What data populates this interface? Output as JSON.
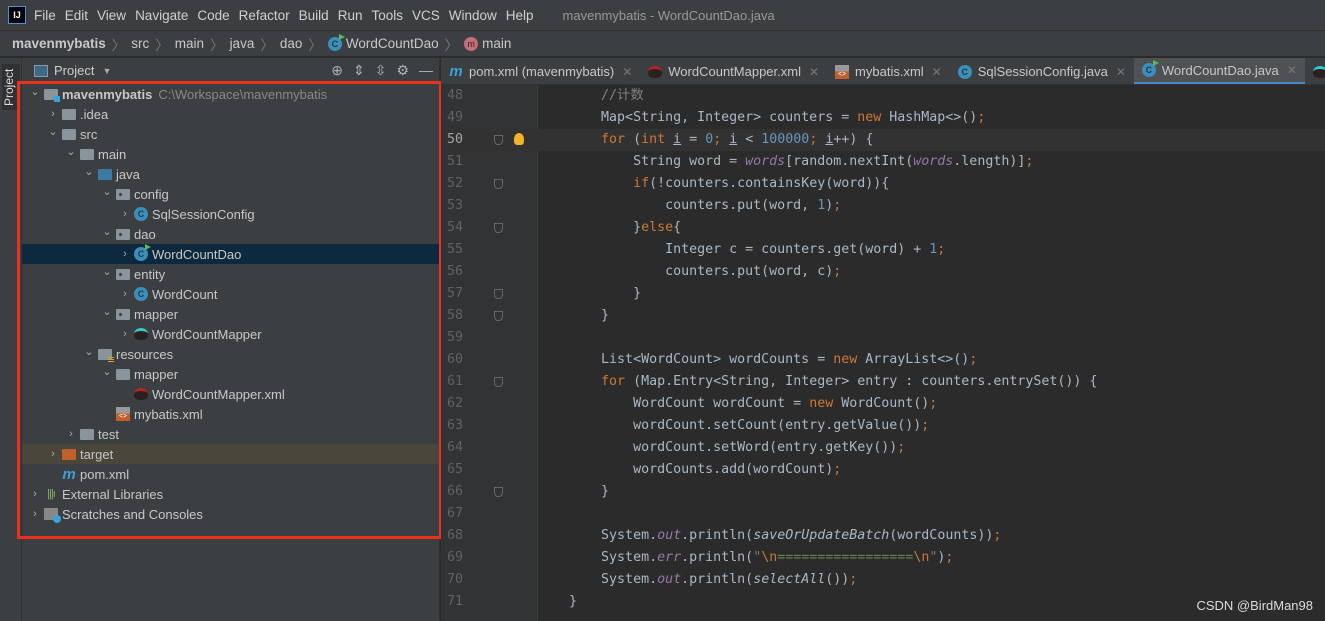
{
  "menubar": {
    "logo": "IJ",
    "items": [
      "File",
      "Edit",
      "View",
      "Navigate",
      "Code",
      "Refactor",
      "Build",
      "Run",
      "Tools",
      "VCS",
      "Window",
      "Help"
    ],
    "title": "mavenmybatis - WordCountDao.java"
  },
  "breadcrumb": {
    "items": [
      "mavenmybatis",
      "src",
      "main",
      "java",
      "dao",
      "WordCountDao",
      "main"
    ]
  },
  "sidebar": {
    "stripe_label": "Project"
  },
  "project": {
    "title": "Project",
    "tree": [
      {
        "label": "mavenmybatis",
        "path": "C:\\Workspace\\mavenmybatis",
        "depth": 0,
        "arrow": "open",
        "icon": "module-folder",
        "bold": true
      },
      {
        "label": ".idea",
        "depth": 1,
        "arrow": "closed",
        "icon": "folder"
      },
      {
        "label": "src",
        "depth": 1,
        "arrow": "open",
        "icon": "folder"
      },
      {
        "label": "main",
        "depth": 2,
        "arrow": "open",
        "icon": "folder"
      },
      {
        "label": "java",
        "depth": 3,
        "arrow": "open",
        "icon": "source-folder"
      },
      {
        "label": "config",
        "depth": 4,
        "arrow": "open",
        "icon": "package"
      },
      {
        "label": "SqlSessionConfig",
        "depth": 5,
        "arrow": "closed",
        "icon": "class"
      },
      {
        "label": "dao",
        "depth": 4,
        "arrow": "open",
        "icon": "package"
      },
      {
        "label": "WordCountDao",
        "depth": 5,
        "arrow": "closed",
        "icon": "class-run",
        "selected": true
      },
      {
        "label": "entity",
        "depth": 4,
        "arrow": "open",
        "icon": "package"
      },
      {
        "label": "WordCount",
        "depth": 5,
        "arrow": "closed",
        "icon": "class"
      },
      {
        "label": "mapper",
        "depth": 4,
        "arrow": "open",
        "icon": "package"
      },
      {
        "label": "WordCountMapper",
        "depth": 5,
        "arrow": "closed",
        "icon": "mybatis-mapper"
      },
      {
        "label": "resources",
        "depth": 3,
        "arrow": "open",
        "icon": "resources-folder"
      },
      {
        "label": "mapper",
        "depth": 4,
        "arrow": "open",
        "icon": "folder"
      },
      {
        "label": "WordCountMapper.xml",
        "depth": 5,
        "arrow": "none",
        "icon": "mybatis-xml"
      },
      {
        "label": "mybatis.xml",
        "depth": 4,
        "arrow": "none",
        "icon": "xml-file"
      },
      {
        "label": "test",
        "depth": 2,
        "arrow": "closed",
        "icon": "folder"
      },
      {
        "label": "target",
        "depth": 1,
        "arrow": "closed",
        "icon": "excluded-folder",
        "excluded": true
      },
      {
        "label": "pom.xml",
        "depth": 1,
        "arrow": "none",
        "icon": "maven"
      },
      {
        "label": "External Libraries",
        "depth": 0,
        "arrow": "closed",
        "icon": "libraries"
      },
      {
        "label": "Scratches and Consoles",
        "depth": 0,
        "arrow": "closed",
        "icon": "scratches"
      }
    ]
  },
  "tabs": [
    {
      "label": "pom.xml (mavenmybatis)",
      "icon": "maven"
    },
    {
      "label": "WordCountMapper.xml",
      "icon": "mybatis-xml"
    },
    {
      "label": "mybatis.xml",
      "icon": "xml-file"
    },
    {
      "label": "SqlSessionConfig.java",
      "icon": "class"
    },
    {
      "label": "WordCountDao.java",
      "icon": "class-run",
      "active": true
    },
    {
      "label": "",
      "icon": "mybatis-mapper"
    }
  ],
  "editor": {
    "current_line": 50,
    "lines": [
      {
        "n": 48,
        "t": [
          [
            "        ",
            ""
          ],
          [
            "//计数",
            "c"
          ]
        ]
      },
      {
        "n": 49,
        "t": [
          [
            "        Map<String, Integer> counters = ",
            ""
          ],
          [
            "new",
            "k"
          ],
          [
            " HashMap<>()",
            ""
          ],
          [
            ";",
            "k"
          ]
        ]
      },
      {
        "n": 50,
        "t": [
          [
            "        ",
            ""
          ],
          [
            "for",
            "k"
          ],
          [
            " (",
            ""
          ],
          [
            "int",
            "k"
          ],
          [
            " ",
            ""
          ],
          [
            "i",
            "u"
          ],
          [
            " = ",
            ""
          ],
          [
            "0",
            "n"
          ],
          [
            "; ",
            "k"
          ],
          [
            "i",
            "u"
          ],
          [
            " < ",
            ""
          ],
          [
            "100000",
            "n"
          ],
          [
            "; ",
            "k"
          ],
          [
            "i",
            "u"
          ],
          [
            "++) {",
            ""
          ]
        ]
      },
      {
        "n": 51,
        "t": [
          [
            "            String word = ",
            ""
          ],
          [
            "words",
            "f"
          ],
          [
            "[random.nextInt(",
            ""
          ],
          [
            "words",
            "f"
          ],
          [
            ".length)]",
            ""
          ],
          [
            ";",
            "k"
          ]
        ]
      },
      {
        "n": 52,
        "t": [
          [
            "            ",
            ""
          ],
          [
            "if",
            "k"
          ],
          [
            "(!counters.containsKey(word)){",
            ""
          ]
        ]
      },
      {
        "n": 53,
        "t": [
          [
            "                counters.put(word, ",
            ""
          ],
          [
            "1",
            "n"
          ],
          [
            ")",
            ""
          ],
          [
            ";",
            "k"
          ]
        ]
      },
      {
        "n": 54,
        "t": [
          [
            "            }",
            ""
          ],
          [
            "else",
            "k"
          ],
          [
            "{",
            ""
          ]
        ]
      },
      {
        "n": 55,
        "t": [
          [
            "                Integer c = counters.get(word) + ",
            ""
          ],
          [
            "1",
            "n"
          ],
          [
            ";",
            "k"
          ]
        ]
      },
      {
        "n": 56,
        "t": [
          [
            "                counters.put(word, c)",
            ""
          ],
          [
            ";",
            "k"
          ]
        ]
      },
      {
        "n": 57,
        "t": [
          [
            "            }",
            ""
          ]
        ]
      },
      {
        "n": 58,
        "t": [
          [
            "        }",
            ""
          ]
        ]
      },
      {
        "n": 59,
        "t": []
      },
      {
        "n": 60,
        "t": [
          [
            "        List<WordCount> wordCounts = ",
            ""
          ],
          [
            "new",
            "k"
          ],
          [
            " ArrayList<>()",
            ""
          ],
          [
            ";",
            "k"
          ]
        ]
      },
      {
        "n": 61,
        "t": [
          [
            "        ",
            ""
          ],
          [
            "for",
            "k"
          ],
          [
            " (Map.Entry<String, Integer> entry : counters.entrySet()) {",
            ""
          ]
        ]
      },
      {
        "n": 62,
        "t": [
          [
            "            WordCount wordCount = ",
            ""
          ],
          [
            "new",
            "k"
          ],
          [
            " WordCount()",
            ""
          ],
          [
            ";",
            "k"
          ]
        ]
      },
      {
        "n": 63,
        "t": [
          [
            "            wordCount.setCount(entry.getValue())",
            ""
          ],
          [
            ";",
            "k"
          ]
        ]
      },
      {
        "n": 64,
        "t": [
          [
            "            wordCount.setWord(entry.getKey())",
            ""
          ],
          [
            ";",
            "k"
          ]
        ]
      },
      {
        "n": 65,
        "t": [
          [
            "            wordCounts.add(wordCount)",
            ""
          ],
          [
            ";",
            "k"
          ]
        ]
      },
      {
        "n": 66,
        "t": [
          [
            "        }",
            ""
          ]
        ]
      },
      {
        "n": 67,
        "t": []
      },
      {
        "n": 68,
        "t": [
          [
            "        System.",
            ""
          ],
          [
            "out",
            "f"
          ],
          [
            ".println(",
            ""
          ],
          [
            "saveOrUpdateBatch",
            "i"
          ],
          [
            "(wordCounts))",
            ""
          ],
          [
            ";",
            "k"
          ]
        ]
      },
      {
        "n": 69,
        "t": [
          [
            "        System.",
            ""
          ],
          [
            "err",
            "f"
          ],
          [
            ".println(",
            ""
          ],
          [
            "\"",
            "s"
          ],
          [
            "\\n",
            "k"
          ],
          [
            "=================",
            "s"
          ],
          [
            "\\n",
            "k"
          ],
          [
            "\"",
            "s"
          ],
          [
            ")",
            ""
          ],
          [
            ";",
            "k"
          ]
        ]
      },
      {
        "n": 70,
        "t": [
          [
            "        System.",
            ""
          ],
          [
            "out",
            "f"
          ],
          [
            ".println(",
            ""
          ],
          [
            "selectAll",
            "i"
          ],
          [
            "())",
            ""
          ],
          [
            ";",
            "k"
          ]
        ]
      },
      {
        "n": 71,
        "t": [
          [
            "    }",
            ""
          ]
        ]
      }
    ]
  },
  "watermark": "CSDN @BirdMan98",
  "colors": {
    "keyword": "#cc7832",
    "number": "#6897bb",
    "string": "#6a8759",
    "comment": "#808080",
    "field": "#9876aa",
    "highlight_box": "#e8321e"
  }
}
